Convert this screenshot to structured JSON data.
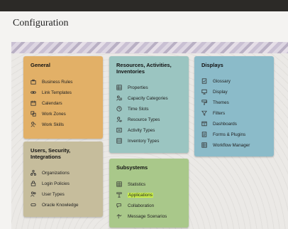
{
  "page": {
    "title": "Configuration"
  },
  "cards": {
    "general": {
      "title": "General",
      "items": [
        {
          "label": "Business Rules",
          "icon": "briefcase-icon"
        },
        {
          "label": "Link Templates",
          "icon": "link-icon"
        },
        {
          "label": "Calendars",
          "icon": "calendar-icon"
        },
        {
          "label": "Work Zones",
          "icon": "work-zones-icon"
        },
        {
          "label": "Work Skills",
          "icon": "work-skills-icon"
        }
      ]
    },
    "users": {
      "title": "Users, Security, Integrations",
      "items": [
        {
          "label": "Organizations",
          "icon": "organizations-icon"
        },
        {
          "label": "Login Policies",
          "icon": "login-policies-icon"
        },
        {
          "label": "User Types",
          "icon": "user-types-icon"
        },
        {
          "label": "Oracle Knowledge",
          "icon": "knowledge-icon"
        }
      ]
    },
    "resources": {
      "title": "Resources, Activities, Inventories",
      "items": [
        {
          "label": "Properties",
          "icon": "properties-icon"
        },
        {
          "label": "Capacity Categories",
          "icon": "capacity-icon"
        },
        {
          "label": "Time Slots",
          "icon": "clock-icon"
        },
        {
          "label": "Resource Types",
          "icon": "resource-types-icon"
        },
        {
          "label": "Activity Types",
          "icon": "activity-types-icon"
        },
        {
          "label": "Inventory Types",
          "icon": "inventory-icon"
        }
      ]
    },
    "subsystems": {
      "title": "Subsystems",
      "items": [
        {
          "label": "Statistics",
          "icon": "statistics-icon"
        },
        {
          "label": "Applications",
          "icon": "applications-icon",
          "highlighted": true
        },
        {
          "label": "Collaboration",
          "icon": "collaboration-icon"
        },
        {
          "label": "Message Scenarios",
          "icon": "message-scenarios-icon"
        }
      ]
    },
    "displays": {
      "title": "Displays",
      "items": [
        {
          "label": "Glossary",
          "icon": "glossary-icon"
        },
        {
          "label": "Display",
          "icon": "display-icon"
        },
        {
          "label": "Themes",
          "icon": "themes-icon"
        },
        {
          "label": "Filters",
          "icon": "filter-icon"
        },
        {
          "label": "Dashboards",
          "icon": "dashboard-icon"
        },
        {
          "label": "Forms & Plugins",
          "icon": "forms-icon"
        },
        {
          "label": "Workflow Manager",
          "icon": "workflow-icon"
        }
      ]
    }
  },
  "colors": {
    "general": "#e2b067",
    "users": "#c6bd9c",
    "resources": "#9bc5c1",
    "subsystems": "#a9c88a",
    "displays": "#8bbbc9",
    "highlight": "#c9ee4a"
  }
}
